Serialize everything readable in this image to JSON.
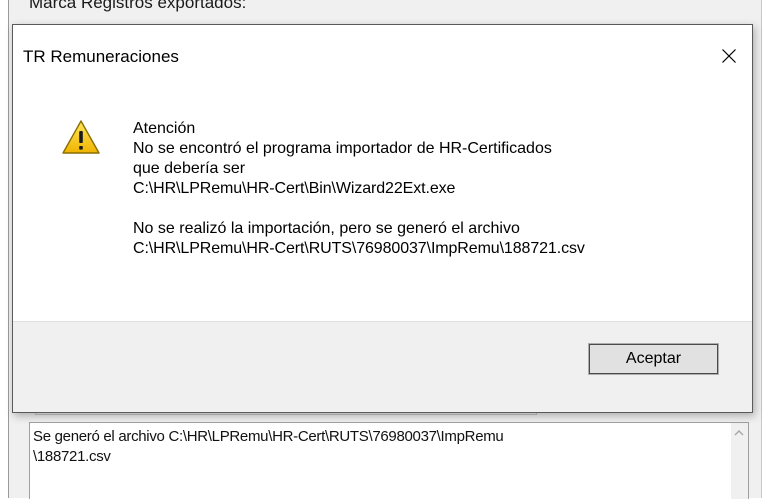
{
  "background_window": {
    "partial_label": "Marca Registros exportados:",
    "log_text": "Se generó el archivo C:\\HR\\LPRemu\\HR-Cert\\RUTS\\76980037\\ImpRemu\n\\188721.csv"
  },
  "dialog": {
    "title": "TR Remuneraciones",
    "icon": "warning-icon",
    "message_lines": [
      "Atención",
      "No se encontró el programa importador de HR-Certificados",
      "que debería ser",
      "C:\\HR\\LPRemu\\HR-Cert\\Bin\\Wizard22Ext.exe",
      "",
      "No se realizó la importación, pero se generó el archivo",
      "C:\\HR\\LPRemu\\HR-Cert\\RUTS\\76980037\\ImpRemu\\188721.csv"
    ],
    "ok_label": "Aceptar"
  },
  "colors": {
    "warning_fill": "#f5c400",
    "warning_border": "#8a6d00",
    "footer_bg": "#f0f0f0"
  }
}
